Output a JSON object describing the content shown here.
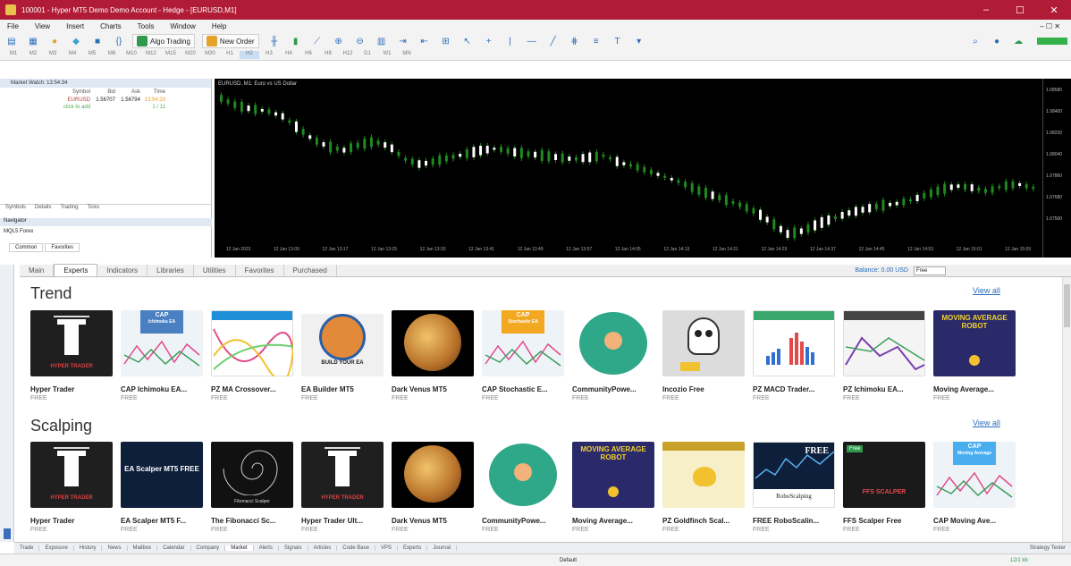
{
  "window": {
    "title": "100001 - Hyper MT5 Demo Demo Account - Hedge - [EURUSD,M1]",
    "min": "–",
    "max": "☐",
    "close": "✕"
  },
  "menu": [
    "File",
    "View",
    "Insert",
    "Charts",
    "Tools",
    "Window",
    "Help"
  ],
  "menu_right": "– ☐ ✕",
  "toolbar": {
    "algo": "Algo Trading",
    "new_order": "New Order",
    "timeframes": [
      "M1",
      "M2",
      "M3",
      "M4",
      "M5",
      "M6",
      "M10",
      "M12",
      "M15",
      "M20",
      "M30",
      "H1",
      "H2",
      "H3",
      "H4",
      "H6",
      "H8",
      "H12",
      "D1",
      "W1",
      "MN"
    ]
  },
  "market_watch": {
    "title": "Market Watch: 13:54:34",
    "cols": [
      "Symbol",
      "Bid",
      "Ask",
      "Time"
    ],
    "rows": [
      {
        "symbol": "EURUSD",
        "bid": "1.56707",
        "ask": "1.56794",
        "time": "13:54:33"
      },
      {
        "symbol": "click to add",
        "bid": "",
        "ask": "",
        "time": "1 / 11"
      }
    ],
    "tabs": [
      "Symbols",
      "Details",
      "Trading",
      "Ticks"
    ]
  },
  "navigator": {
    "title": "Navigator",
    "item": "MQL5 Forex",
    "tabs": [
      "Common",
      "Favorites"
    ]
  },
  "chart": {
    "title": "EURUSD, M1: Euro vs US Dollar",
    "x_ticks": [
      "12 Jan 2023",
      "12 Jan 13:09",
      "12 Jan 13:17",
      "12 Jan 13:25",
      "12 Jan 13:33",
      "12 Jan 13:41",
      "12 Jan 13:49",
      "12 Jan 13:57",
      "12 Jan 14:05",
      "12 Jan 14:13",
      "12 Jan 14:21",
      "12 Jan 14:29",
      "12 Jan 14:37",
      "12 Jan 14:45",
      "12 Jan 14:53",
      "12 Jan 15:01",
      "12 Jan 15:09"
    ],
    "y_ticks": [
      "1.08580",
      "1.08400",
      "1.08220",
      "1.08040",
      "1.07860",
      "1.07680",
      "1.07500"
    ]
  },
  "market_tabs": [
    "Main",
    "Experts",
    "Indicators",
    "Libraries",
    "Utilities",
    "Favorites",
    "Purchased"
  ],
  "active_tab": "Experts",
  "balance": "Balance: 0.00 USD",
  "filter": "Free",
  "sections": [
    {
      "title": "Trend",
      "view_all": "View all",
      "items": [
        {
          "name": "Hyper Trader",
          "price": "FREE",
          "thumb": "hyper"
        },
        {
          "name": "CAP Ichimoku EA...",
          "price": "FREE",
          "thumb": "cap-ichi"
        },
        {
          "name": "PZ MA Crossover...",
          "price": "FREE",
          "thumb": "pz-ma"
        },
        {
          "name": "EA Builder MT5",
          "price": "FREE",
          "thumb": "builder"
        },
        {
          "name": "Dark Venus MT5",
          "price": "FREE",
          "thumb": "venus"
        },
        {
          "name": "CAP Stochastic E...",
          "price": "FREE",
          "thumb": "cap-stoch"
        },
        {
          "name": "CommunityPowe...",
          "price": "FREE",
          "thumb": "community"
        },
        {
          "name": "Incozio Free",
          "price": "FREE",
          "thumb": "skull"
        },
        {
          "name": "PZ MACD Trader...",
          "price": "FREE",
          "thumb": "pz-macd"
        },
        {
          "name": "PZ Ichimoku EA...",
          "price": "FREE",
          "thumb": "pz-ichi"
        },
        {
          "name": "Moving Average...",
          "price": "FREE",
          "thumb": "mar"
        }
      ]
    },
    {
      "title": "Scalping",
      "view_all": "View all",
      "items": [
        {
          "name": "Hyper Trader",
          "price": "FREE",
          "thumb": "hyper"
        },
        {
          "name": "EA Scalper MT5 F...",
          "price": "FREE",
          "thumb": "scalper"
        },
        {
          "name": "The Fibonacci Sc...",
          "price": "FREE",
          "thumb": "fib"
        },
        {
          "name": "Hyper Trader Ult...",
          "price": "FREE",
          "thumb": "hyper"
        },
        {
          "name": "Dark Venus MT5",
          "price": "FREE",
          "thumb": "venus"
        },
        {
          "name": "CommunityPowe...",
          "price": "FREE",
          "thumb": "community"
        },
        {
          "name": "Moving Average...",
          "price": "FREE",
          "thumb": "mar"
        },
        {
          "name": "PZ Goldfinch Scal...",
          "price": "FREE",
          "thumb": "goldfinch"
        },
        {
          "name": "FREE RoboScalin...",
          "price": "FREE",
          "thumb": "robo"
        },
        {
          "name": "FFS Scalper Free",
          "price": "FREE",
          "thumb": "ffs"
        },
        {
          "name": "CAP Moving Ave...",
          "price": "FREE",
          "thumb": "cap-ma"
        }
      ]
    }
  ],
  "thumb_text": {
    "hyper": "HYPER TRADER",
    "cap": "CAP",
    "cap_ichi": "Ichimoku EA",
    "cap_stoch": "Stochastic EA",
    "cap_ma": "Moving Average",
    "builder": "BUILD YOUR EA",
    "mar": "MOVING AVERAGE ROBOT",
    "scalper": "EA Scalper MT5 FREE",
    "fib": "Fibonacci Scalper",
    "robo": "FREE",
    "robo_sub": "RoboScalping",
    "ffs": "FFS SCALPER",
    "ffs_free": "Free"
  },
  "bottom_tabs": [
    "Trade",
    "Exposure",
    "History",
    "News",
    "Mailbox",
    "Calendar",
    "Company",
    "Market",
    "Alerts",
    "Signals",
    "Articles",
    "Code Base",
    "VPS",
    "Experts",
    "Journal"
  ],
  "active_bottom": "Market",
  "strategy_tester": "Strategy Tester",
  "status": {
    "profile": "Default",
    "net": "12/1 kb"
  },
  "colors": {
    "titlebar": "#b01c35",
    "chart_bg": "#000000",
    "candle_up": "#ffffff",
    "candle_down": "#1f8a1f",
    "link": "#2a6ebb"
  }
}
